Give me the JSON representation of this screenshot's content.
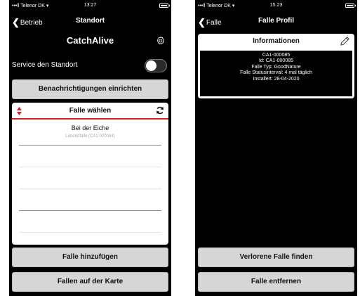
{
  "phone1": {
    "status": {
      "left": "•••ll Telenor DK ▾",
      "time": "13:27"
    },
    "nav": {
      "back": "Betrieb",
      "title": "Standort"
    },
    "app_title": "CatchAlive",
    "service": {
      "label": "Service den Standort",
      "enabled": false
    },
    "notifications_button": "Benachrichtigungen einrichten",
    "picker": {
      "title": "Falle wählen",
      "items": [
        {
          "name": "Bei der Eiche",
          "sub": "Lebendfalle (CA1-000084)"
        }
      ]
    },
    "add_trap_button": "Falle hinzufügen",
    "map_button": "Fallen auf der Karte"
  },
  "phone2": {
    "status": {
      "left": "•••ll Telenor DK ▾",
      "time": "15.23"
    },
    "nav": {
      "back": "Falle",
      "title": "Falle Profil"
    },
    "info": {
      "title": "Informationen",
      "lines": [
        "CA1-000085",
        "Id: CA1-000085",
        "Falle Typ: GoodNature",
        "Falle Statusinterval: 4 mal täglich",
        "Installert: 28-04-2020"
      ]
    },
    "find_lost_button": "Verlorene Falle finden",
    "remove_button": "Falle entfernen"
  },
  "colors": {
    "accent_red": "#d21e1e",
    "button_gray": "#d6d6d6",
    "background": "#000000"
  },
  "icons": [
    "gear-icon",
    "sort-arrows-icon",
    "refresh-icon",
    "pencil-icon",
    "chevron-left-icon",
    "battery-icon"
  ]
}
